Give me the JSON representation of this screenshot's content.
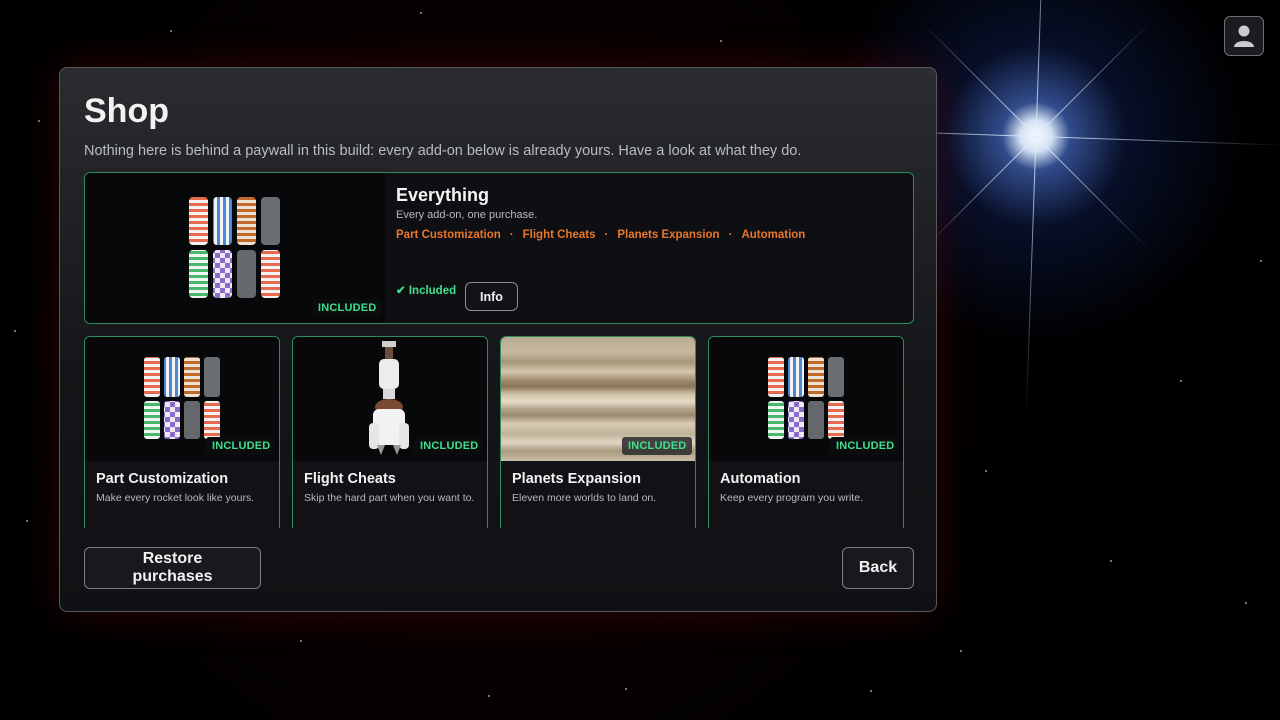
{
  "shop": {
    "title": "Shop",
    "subtitle": "Nothing here is behind a paywall in this build: every add-on below is already yours. Have a look at what they do."
  },
  "featured": {
    "name": "Everything",
    "description": "Every add-on, one purchase.",
    "tags": [
      "Part Customization",
      "Flight Cheats",
      "Planets Expansion",
      "Automation"
    ],
    "tag_separator": "·",
    "status": "Included",
    "badge": "INCLUDED",
    "info_label": "Info"
  },
  "cards": [
    {
      "name": "Part Customization",
      "description": "Make every rocket look like yours.",
      "badge": "INCLUDED"
    },
    {
      "name": "Flight Cheats",
      "description": "Skip the hard part when you want to.",
      "badge": "INCLUDED"
    },
    {
      "name": "Planets Expansion",
      "description": "Eleven more worlds to land on.",
      "badge": "INCLUDED"
    },
    {
      "name": "Automation",
      "description": "Keep every program you write.",
      "badge": "INCLUDED"
    }
  ],
  "footer": {
    "restore_label": "Restore purchases",
    "back_label": "Back"
  },
  "icons": {
    "profile": "user-icon",
    "check": "checkmark-icon"
  },
  "colors": {
    "accent_green": "#3ee08e",
    "tag_orange": "#e8772e",
    "card_border": "#2f8a5e"
  }
}
